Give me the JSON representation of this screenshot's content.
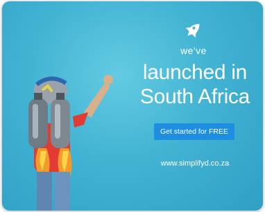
{
  "ad": {
    "tagline": "we've",
    "headline_line1": "launched in",
    "headline_line2": "South Africa",
    "cta_label": "Get started for FREE",
    "url": "www.simplifyd.co.za"
  },
  "colors": {
    "background": "#42b3d3",
    "cta": "#1e8fe0",
    "text": "#ffffff"
  },
  "icons": [
    "rocket-icon"
  ]
}
